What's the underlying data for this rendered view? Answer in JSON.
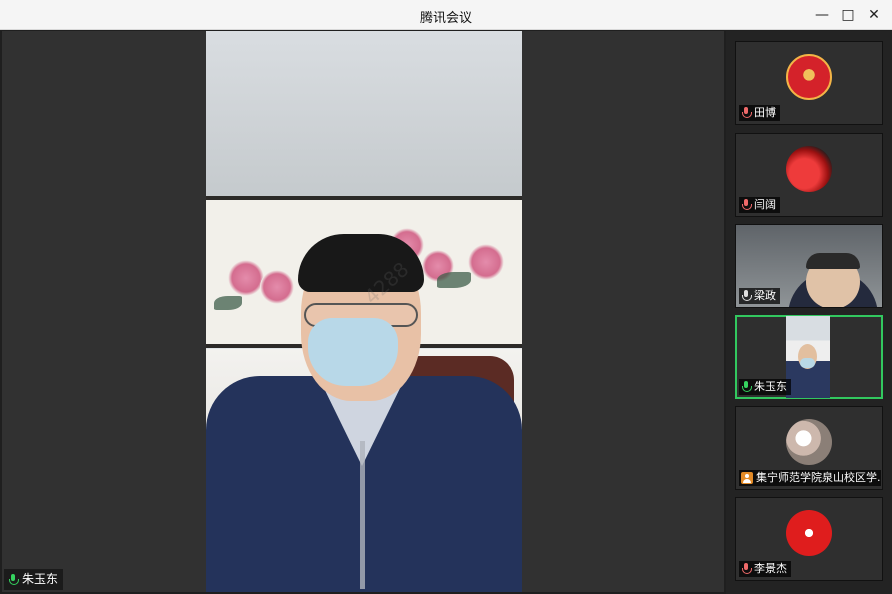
{
  "window": {
    "title": "腾讯会议",
    "controls": {
      "minimize": "—",
      "maximize": "□",
      "close": "✕"
    }
  },
  "main_speaker": {
    "name": "朱玉东",
    "watermark": "4288"
  },
  "participants": [
    {
      "name": "田博",
      "status": "muted"
    },
    {
      "name": "闫阔",
      "status": "muted"
    },
    {
      "name": "梁政",
      "status": "speaking-muted"
    },
    {
      "name": "朱玉东",
      "status": "active"
    },
    {
      "name": "集宁师范学院泉山校区学...",
      "status": "profile"
    },
    {
      "name": "李景杰",
      "status": "muted"
    }
  ],
  "colors": {
    "active_border": "#32c85f",
    "main_bg": "#313131"
  },
  "icons": {
    "mic": "microphone-icon",
    "user": "user-icon"
  }
}
